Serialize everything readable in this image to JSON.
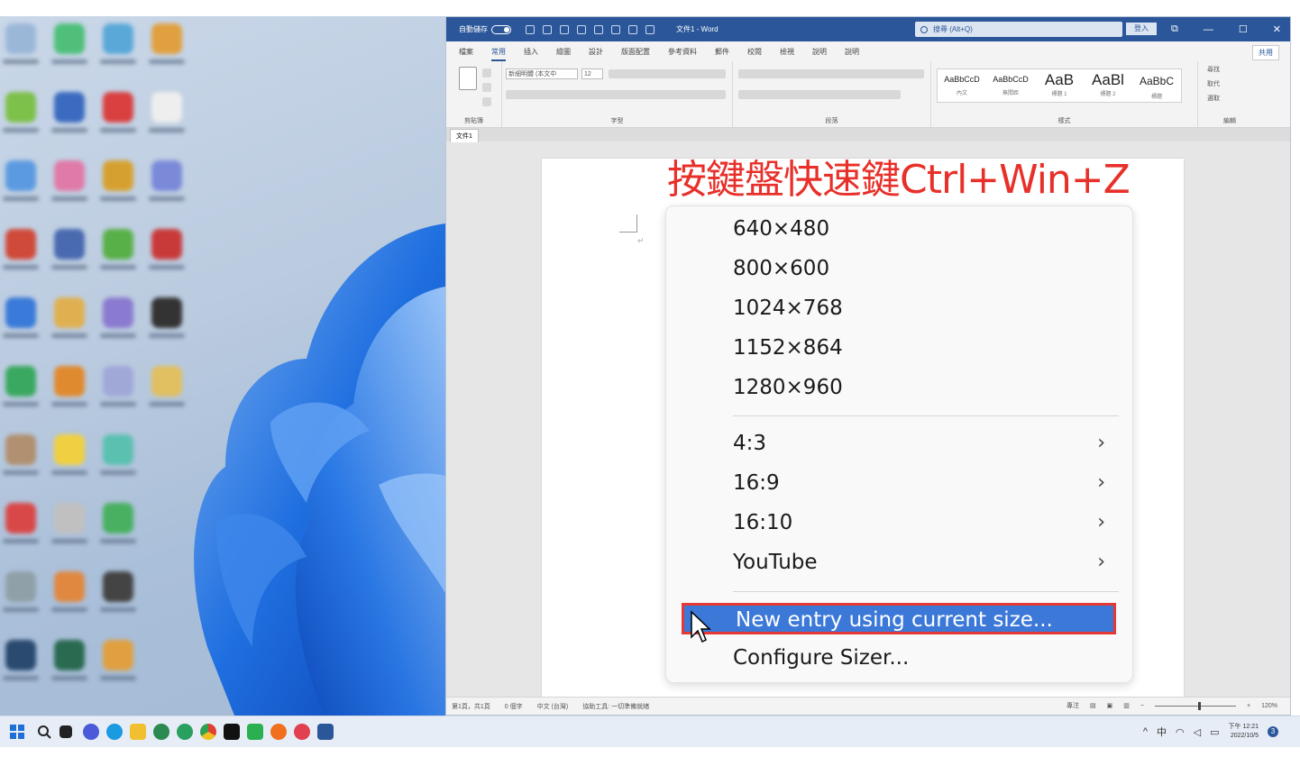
{
  "caption": "按鍵盤快速鍵Ctrl+Win+Z",
  "word": {
    "autosave": "自動儲存",
    "autosave_state": "關閉",
    "title": "文件1 - Word",
    "search_placeholder": "搜尋 (Alt+Q)",
    "signin": "登入",
    "tabs": [
      "檔案",
      "常用",
      "插入",
      "繪圖",
      "設計",
      "版面配置",
      "參考資料",
      "郵件",
      "校閱",
      "檢視",
      "說明",
      "說明"
    ],
    "active_tab": "常用",
    "share": "共用",
    "groups": [
      "剪貼簿",
      "字型",
      "段落",
      "樣式",
      "編輯"
    ],
    "font_name": "新細明體 (本文中",
    "font_size": "12",
    "styles": [
      {
        "sample": "AaBbCcD",
        "name": "內文"
      },
      {
        "sample": "AaBbCcD",
        "name": "無間距"
      },
      {
        "sample": "AaB",
        "name": "標題 1"
      },
      {
        "sample": "AaBl",
        "name": "標題 2"
      },
      {
        "sample": "AaBbC",
        "name": "標題"
      }
    ],
    "editing": [
      "尋找",
      "取代",
      "選取"
    ],
    "doc_tab": "文件1",
    "status": {
      "page": "第1頁，共1頁",
      "words": "0 個字",
      "lang": "中文 (台灣)",
      "accessibility": "協助工具: 一切準備就緒",
      "focus": "專注",
      "zoom": "120%"
    }
  },
  "menu": {
    "sizes": [
      "640×480",
      "800×600",
      "1024×768",
      "1152×864",
      "1280×960"
    ],
    "submenus": [
      "4:3",
      "16:9",
      "16:10",
      "YouTube"
    ],
    "selected": "New entry using current size...",
    "configure": "Configure Sizer..."
  },
  "taskbar": {
    "input_method": "中",
    "time": "下午 12:21",
    "date": "2022/10/5",
    "notification_count": "3"
  },
  "colors": {
    "word_blue": "#2b579a",
    "caption_red": "#e8302a",
    "highlight_blue": "#3b78d8",
    "highlight_border": "#e53935"
  }
}
